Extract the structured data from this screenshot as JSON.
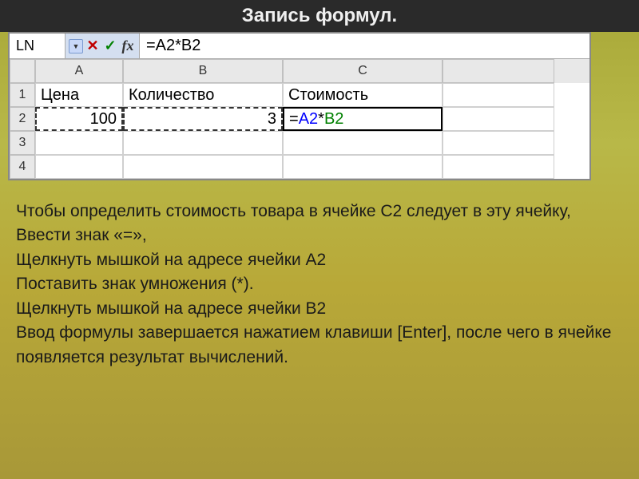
{
  "title": "Запись формул.",
  "formulaBar": {
    "nameBox": "LN",
    "cancel": "✕",
    "confirm": "✓",
    "fx": "fx",
    "formula": "=A2*B2"
  },
  "columns": [
    "A",
    "B",
    "C"
  ],
  "rows": [
    "1",
    "2",
    "3",
    "4"
  ],
  "data": {
    "A1": "Цена",
    "B1": "Количество",
    "C1": "Стоимость",
    "A2": "100",
    "B2": "3",
    "C2_prefix": "=",
    "C2_refA": "A2",
    "C2_op": "*",
    "C2_refB": "B2"
  },
  "explanation": {
    "l1": "Чтобы определить стоимость товара в ячейке С2 следует в эту ячейку,",
    "l2": "Ввести знак «=»,",
    "l3": "Щелкнуть мышкой на адресе ячейки А2",
    "l4": "Поставить знак умножения (*).",
    "l5": "Щелкнуть мышкой на адресе ячейки В2",
    "l6": "Ввод формулы завершается нажатием клавиши [Enter], после чего в ячейке появляется результат вычислений."
  }
}
